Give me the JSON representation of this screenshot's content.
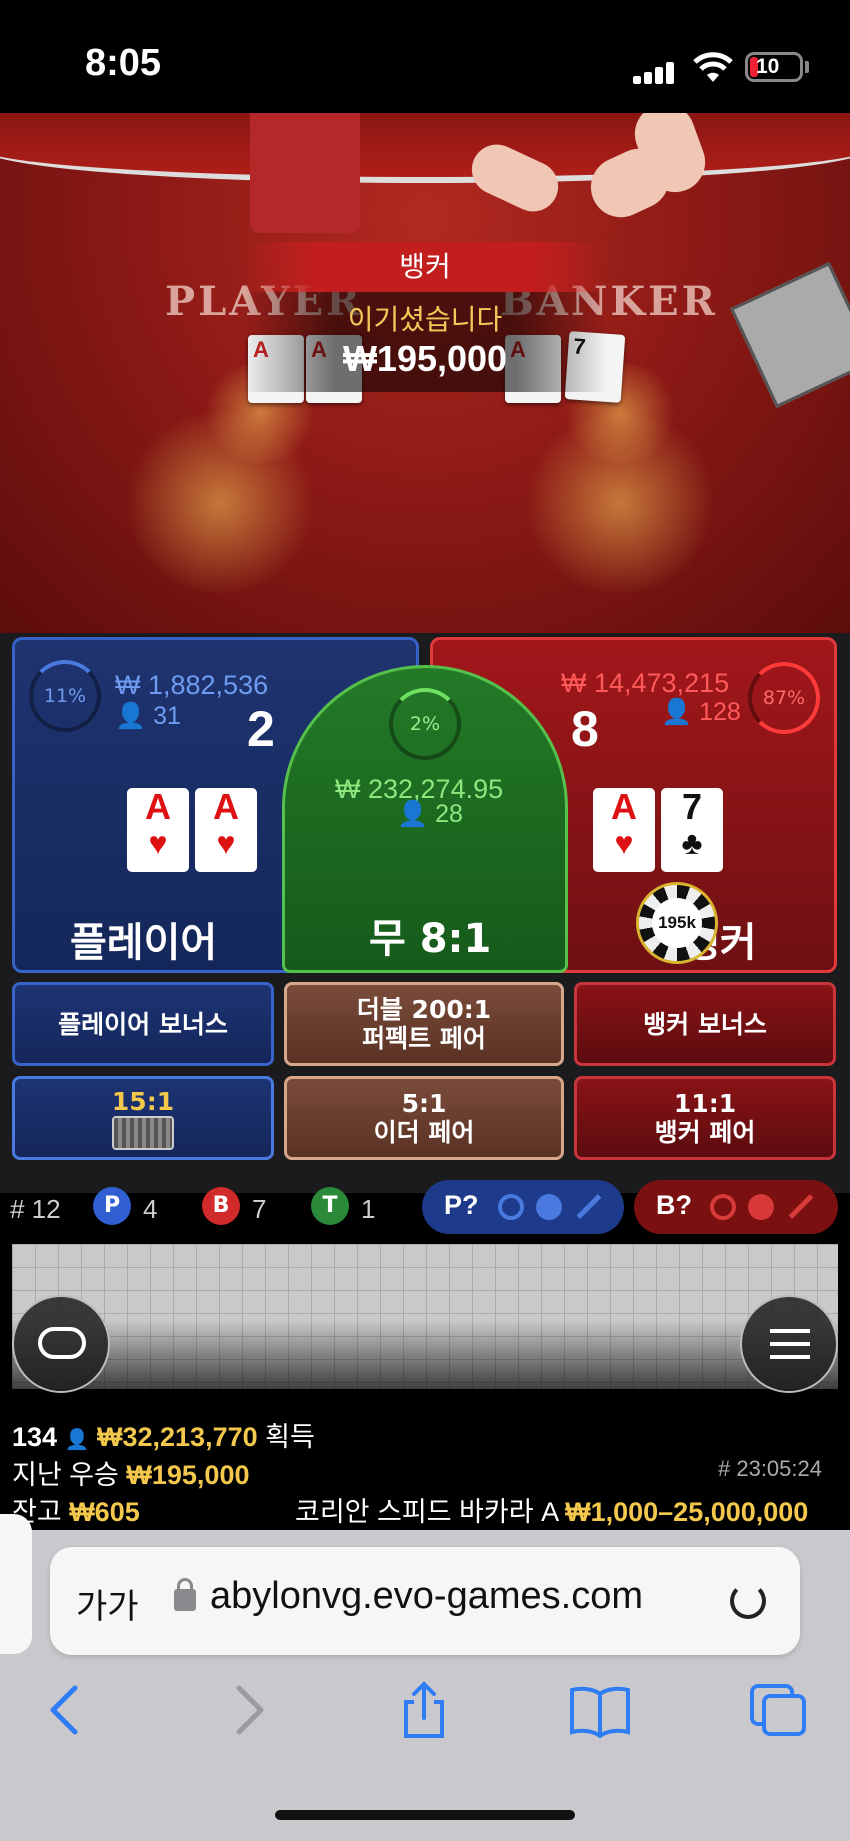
{
  "status_bar": {
    "time": "8:05",
    "battery": "10"
  },
  "video": {
    "table_player_label": "PLAYER",
    "table_banker_label": "BANKER",
    "result_banner": {
      "winner": "뱅커",
      "message": "이기셨습니다",
      "amount": "₩195,000"
    },
    "player_cards": [
      "A",
      "A"
    ],
    "banker_cards": [
      "A",
      "7"
    ]
  },
  "board": {
    "player": {
      "percent": "11%",
      "bet_total": "₩ 1,882,536",
      "bettors": "31",
      "score": "2",
      "label": "플레이어",
      "cards": [
        {
          "rank": "A",
          "suit": "♥"
        },
        {
          "rank": "A",
          "suit": "♥"
        }
      ]
    },
    "tie": {
      "percent": "2%",
      "bet_total": "₩ 232,274.95",
      "bettors": "28",
      "label": "무 8:1"
    },
    "banker": {
      "percent": "87%",
      "bet_total": "₩ 14,473,215",
      "bettors": "128",
      "score": "8",
      "label": "뱅커",
      "cards": [
        {
          "rank": "A",
          "suit": "♥"
        },
        {
          "rank": "7",
          "suit": "♣"
        }
      ]
    },
    "chip": "195k",
    "side_bets": {
      "player_bonus": "플레이어 보너스",
      "perfect_pair_1": "더블 200:1",
      "perfect_pair_2": "퍼펙트 페어",
      "banker_bonus": "뱅커 보너스",
      "player_pair": "15:1",
      "either_pair_1": "5:1",
      "either_pair_2": "이더 페어",
      "banker_pair_1": "11:1",
      "banker_pair_2": "뱅커 페어"
    }
  },
  "stats": {
    "round_prefix": "# 12",
    "p_label": "P",
    "p_count": "4",
    "b_label": "B",
    "b_count": "7",
    "t_label": "T",
    "t_count": "1",
    "player_predict": "P?",
    "banker_predict": "B?"
  },
  "info": {
    "winners": "134",
    "total_won": "₩32,213,770",
    "won_label": "획득",
    "last_win_label": "지난 우승",
    "last_win": "₩195,000",
    "game_id": "# 23:05:24",
    "balance_label": "잔고",
    "balance": "₩605",
    "table_name": "코리안 스피드 바카라 A",
    "limits": "₩1,000–25,000,000"
  },
  "browser": {
    "text_size": "가가",
    "url": "abylonvg.evo-games.com"
  },
  "colors": {
    "player": "#3762c7",
    "banker": "#e03a3a",
    "tie": "#55c14c",
    "gold": "#f4c84c"
  }
}
